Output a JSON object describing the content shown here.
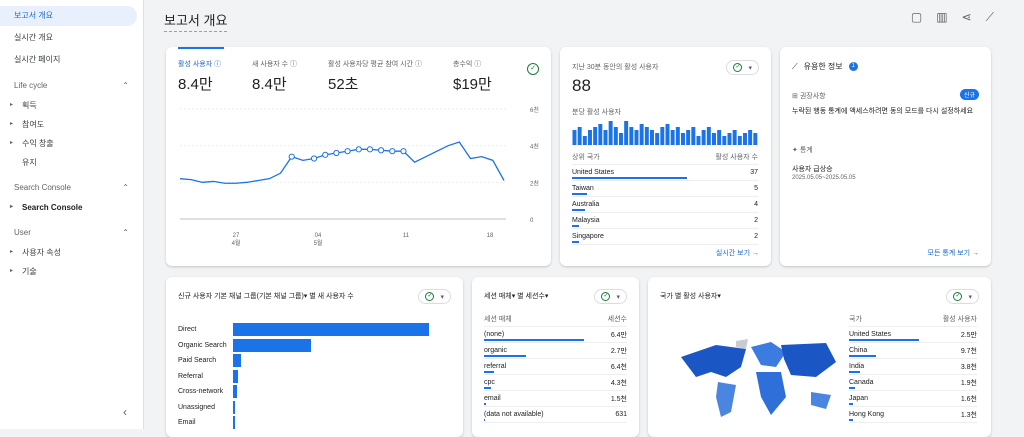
{
  "sidebar": {
    "nav": [
      "보고서 개요",
      "실시간 개요",
      "실시간 페이지"
    ],
    "lifecycle": {
      "label": "Life cycle",
      "items": [
        "획득",
        "참여도",
        "수익 창출",
        "유지"
      ]
    },
    "sc": {
      "label": "Search Console",
      "items": [
        "Search Console"
      ]
    },
    "user": {
      "label": "User",
      "items": [
        "사용자 속성",
        "기술"
      ]
    }
  },
  "header": {
    "title": "보고서 개요"
  },
  "metrics": [
    {
      "label": "활성 사용자",
      "value": "8.4만"
    },
    {
      "label": "새 사용자 수",
      "value": "8.4만"
    },
    {
      "label": "활성 사용자당 평균 참여 시간",
      "value": "52초"
    },
    {
      "label": "총수익",
      "value": "$19만"
    }
  ],
  "line_chart": {
    "y_ticks": [
      "6천",
      "4천",
      "2천",
      "0"
    ],
    "x_ticks": [
      [
        "27",
        "4월"
      ],
      [
        "04",
        "5월"
      ],
      [
        "11",
        ""
      ],
      [
        "18",
        ""
      ]
    ],
    "values": [
      2.2,
      2.15,
      2.0,
      2.05,
      1.95,
      1.95,
      2.0,
      2.1,
      2.2,
      2.5,
      3.4,
      3.2,
      3.3,
      3.5,
      3.6,
      3.7,
      3.8,
      3.8,
      3.75,
      3.7,
      3.7,
      3.1,
      3.4,
      3.7,
      4.0,
      4.2,
      3.3,
      3.4,
      3.2,
      2.1
    ]
  },
  "realtime": {
    "label": "지난 30분 동안의 활성 사용자",
    "value": "88",
    "sub": "분당 활성 사용자",
    "col1": "상위 국가",
    "col2": "활성 사용자 수",
    "rows": [
      {
        "name": "United States",
        "v": "37",
        "p": 0.82
      },
      {
        "name": "Taiwan",
        "v": "5",
        "p": 0.11
      },
      {
        "name": "Australia",
        "v": "4",
        "p": 0.09
      },
      {
        "name": "Malaysia",
        "v": "2",
        "p": 0.05
      },
      {
        "name": "Singapore",
        "v": "2",
        "p": 0.05
      }
    ],
    "link": "실시간 보기",
    "bars": [
      5,
      6,
      3,
      5,
      6,
      7,
      5,
      8,
      6,
      4,
      8,
      6,
      5,
      7,
      6,
      5,
      4,
      6,
      7,
      5,
      6,
      4,
      5,
      6,
      3,
      5,
      6,
      4,
      5,
      3,
      4,
      5,
      3,
      4,
      5,
      4
    ]
  },
  "insights": {
    "title": "유용한 정보",
    "badge": "1",
    "tag1": "권장사항",
    "new": "신규",
    "text1": "누락된 행동 통계에 액세스하려면 동의 모드를 다시 설정하세요",
    "tag2": "통계",
    "t2": "사용자 급상승",
    "date": "2025.05.05~2025.05.05",
    "link": "모든 통계 보기"
  },
  "channel": {
    "title": "신규 사용자 기본 채널 그룹(기본 채널 그룹)▾ 별 새 사용자 수",
    "rows": [
      {
        "n": "Direct",
        "v": 1
      },
      {
        "n": "Organic Search",
        "v": 0.4
      },
      {
        "n": "Paid Search",
        "v": 0.04
      },
      {
        "n": "Referral",
        "v": 0.025
      },
      {
        "n": "Cross-network",
        "v": 0.02
      },
      {
        "n": "Unassigned",
        "v": 0.01
      },
      {
        "n": "Email",
        "v": 0.008
      }
    ]
  },
  "session": {
    "title": "세션 매체▾ 별 세션수▾",
    "col1": "세션 매체",
    "col2": "세션수",
    "rows": [
      {
        "n": "(none)",
        "v": "6.4만",
        "p": 1
      },
      {
        "n": "organic",
        "v": "2.7만",
        "p": 0.42
      },
      {
        "n": "referral",
        "v": "6.4천",
        "p": 0.1
      },
      {
        "n": "cpc",
        "v": "4.3천",
        "p": 0.07
      },
      {
        "n": "email",
        "v": "1.5천",
        "p": 0.02
      },
      {
        "n": "(data not available)",
        "v": "631",
        "p": 0.01
      }
    ]
  },
  "country": {
    "title": "국가 별 활성 사용자▾",
    "col1": "국가",
    "col2": "활성 사용자",
    "rows": [
      {
        "n": "United States",
        "v": "2.5만",
        "p": 1
      },
      {
        "n": "China",
        "v": "9.7천",
        "p": 0.39
      },
      {
        "n": "India",
        "v": "3.8천",
        "p": 0.15
      },
      {
        "n": "Canada",
        "v": "1.9천",
        "p": 0.08
      },
      {
        "n": "Japan",
        "v": "1.6천",
        "p": 0.06
      },
      {
        "n": "Hong Kong",
        "v": "1.3천",
        "p": 0.05
      }
    ]
  },
  "colors": {
    "accent": "#1a73e8"
  }
}
